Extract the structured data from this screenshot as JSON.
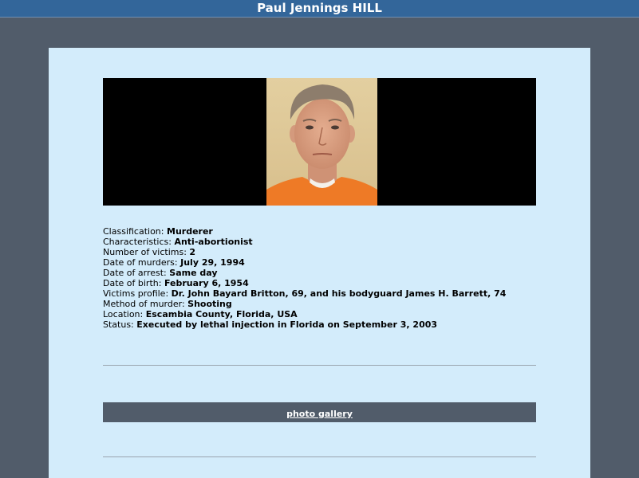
{
  "header": {
    "title": "Paul Jennings HILL"
  },
  "profile": {
    "fields": [
      {
        "label": "Classification:",
        "value": "Murderer"
      },
      {
        "label": "Characteristics:",
        "value": "Anti-abortionist"
      },
      {
        "label": "Number of victims:",
        "value": "2"
      },
      {
        "label": "Date of murders:",
        "value": "July 29, 1994"
      },
      {
        "label": "Date of arrest:",
        "value": "Same day"
      },
      {
        "label": "Date of birth:",
        "value": "February 6, 1954"
      },
      {
        "label": "Victims profile:",
        "value": "Dr. John Bayard Britton, 69, and his bodyguard James H. Barrett, 74"
      },
      {
        "label": "Method of murder:",
        "value": "Shooting"
      },
      {
        "label": "Location:",
        "value": "Escambia County, Florida, USA"
      },
      {
        "label": "Status:",
        "value": "Executed by lethal injection in Florida on September 3, 2003"
      }
    ]
  },
  "gallery": {
    "link_label": "photo gallery"
  },
  "colors": {
    "title_bar": "#33669a",
    "page_background": "#515c6a",
    "content_panel": "#d3ecfb",
    "gallery_bar": "#515c6a"
  }
}
